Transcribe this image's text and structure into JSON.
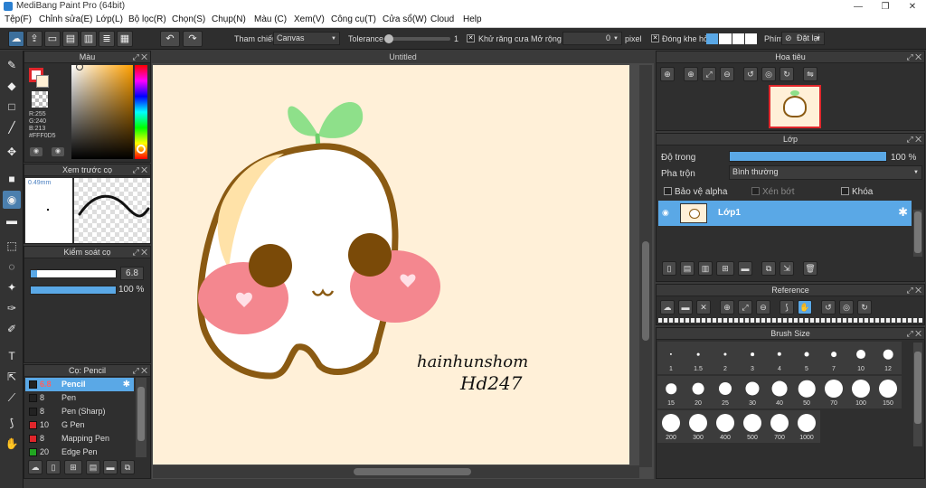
{
  "window": {
    "title": "MediBang Paint Pro (64bit)",
    "min": "—",
    "max": "❐",
    "close": "✕"
  },
  "menu": [
    "Tệp(F)",
    "Chỉnh sửa(E)",
    "Lớp(L)",
    "Bộ lọc(R)",
    "Chọn(S)",
    "Chụp(N)",
    "Màu (C)",
    "Xem(V)",
    "Công cụ(T)",
    "Cửa sổ(W)",
    "Cloud",
    "Help"
  ],
  "toolbar": {
    "ref_label": "Tham chiếu",
    "ref_value": "Canvas",
    "tolerance_label": "Tolerance",
    "tolerance_value": "1",
    "antialias_label": "Khử răng cưa",
    "expand_label": "Mở rộng",
    "expand_value": "0",
    "expand_unit": "pixel",
    "close_gap_label": "Đóng khe hở",
    "key_label": "Phím",
    "reset_label": "Đặt lại"
  },
  "color_panel": {
    "title": "Màu",
    "r": "R:255",
    "g": "G:240",
    "b": "B:213",
    "hex": "#FFF0D5",
    "fg_color": "#e0262b",
    "bg_color": "#fff0d5"
  },
  "preview_panel": {
    "title": "Xem trước cọ",
    "size": "0.49mm"
  },
  "brush_control": {
    "title": "Kiểm soát cọ",
    "size_value": "6.8",
    "opacity_value": "100 %",
    "size_fraction": 0.07,
    "opacity_fraction": 1.0
  },
  "brush_list": {
    "title": "Cọ: Pencil",
    "items": [
      {
        "size": "6.8",
        "name": "Pencil",
        "color": "#222222",
        "selected": true
      },
      {
        "size": "8",
        "name": "Pen",
        "color": "#222222",
        "selected": false
      },
      {
        "size": "8",
        "name": "Pen (Sharp)",
        "color": "#222222",
        "selected": false
      },
      {
        "size": "10",
        "name": "G Pen",
        "color": "#e0262b",
        "selected": false
      },
      {
        "size": "8",
        "name": "Mapping Pen",
        "color": "#e0262b",
        "selected": false
      },
      {
        "size": "20",
        "name": "Edge Pen",
        "color": "#21a621",
        "selected": false
      }
    ]
  },
  "document": {
    "tab": "Untitled",
    "signature_line1": "hainhunshom",
    "signature_line2": "Hd247"
  },
  "navigator": {
    "title": "Hoa tiêu"
  },
  "layers": {
    "title": "Lớp",
    "opacity_label": "Độ trong",
    "opacity_value": "100 %",
    "opacity_fraction": 1.0,
    "blend_label": "Pha trộn",
    "blend_value": "Bình thường",
    "protect_alpha": "Bảo vệ alpha",
    "clipping": "Xén bớt",
    "lock": "Khóa",
    "layer_name": "Lớp1"
  },
  "reference": {
    "title": "Reference"
  },
  "brush_size": {
    "title": "Brush Size",
    "sizes": [
      "1",
      "1.5",
      "2",
      "3",
      "4",
      "5",
      "7",
      "10",
      "12",
      "15",
      "20",
      "25",
      "30",
      "40",
      "50",
      "70",
      "100",
      "150",
      "200",
      "300",
      "400",
      "500",
      "700",
      "1000"
    ]
  }
}
